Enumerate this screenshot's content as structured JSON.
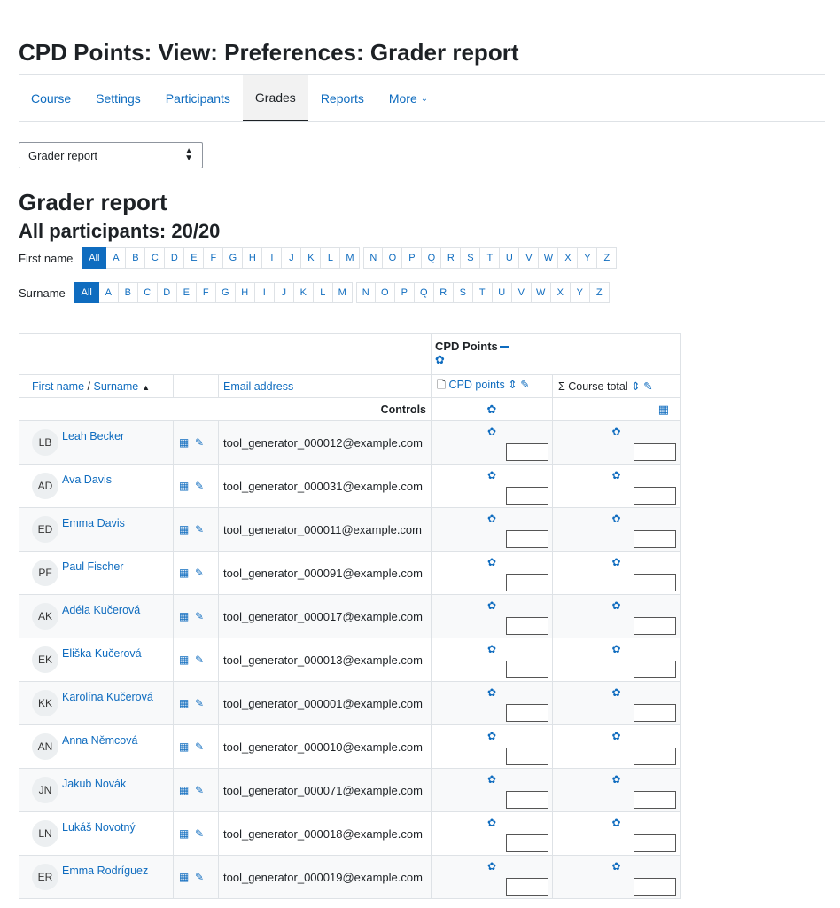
{
  "page": {
    "title": "CPD Points: View: Preferences: Grader report"
  },
  "nav": {
    "tabs": [
      {
        "label": "Course"
      },
      {
        "label": "Settings"
      },
      {
        "label": "Participants"
      },
      {
        "label": "Grades"
      },
      {
        "label": "Reports"
      },
      {
        "label": "More"
      }
    ],
    "active": "Grades"
  },
  "report_select": {
    "value": "Grader report"
  },
  "heading": "Grader report",
  "participants": "All participants: 20/20",
  "first_name_filter": {
    "label": "First name",
    "letters": [
      "All",
      "A",
      "B",
      "C",
      "D",
      "E",
      "F",
      "G",
      "H",
      "I",
      "J",
      "K",
      "L",
      "M",
      "N",
      "O",
      "P",
      "Q",
      "R",
      "S",
      "T",
      "U",
      "V",
      "W",
      "X",
      "Y",
      "Z"
    ]
  },
  "surname_filter": {
    "label": "Surname",
    "letters": [
      "All",
      "A",
      "B",
      "C",
      "D",
      "E",
      "F",
      "G",
      "H",
      "I",
      "J",
      "K",
      "L",
      "M",
      "N",
      "O",
      "P",
      "Q",
      "R",
      "S",
      "T",
      "U",
      "V",
      "W",
      "X",
      "Y",
      "Z"
    ]
  },
  "table": {
    "category": "CPD Points",
    "col_firstname": "First name",
    "col_sep": "/",
    "col_surname": "Surname",
    "col_email": "Email address",
    "col_cpd": "CPD points",
    "col_total": "Course total",
    "controls": "Controls",
    "rows": [
      {
        "initials": "LB",
        "name": "Leah Becker",
        "email": "tool_generator_000012@example.com"
      },
      {
        "initials": "AD",
        "name": "Ava Davis",
        "email": "tool_generator_000031@example.com"
      },
      {
        "initials": "ED",
        "name": "Emma Davis",
        "email": "tool_generator_000011@example.com"
      },
      {
        "initials": "PF",
        "name": "Paul Fischer",
        "email": "tool_generator_000091@example.com"
      },
      {
        "initials": "AK",
        "name": "Adéla Kučerová",
        "email": "tool_generator_000017@example.com"
      },
      {
        "initials": "EK",
        "name": "Eliška Kučerová",
        "email": "tool_generator_000013@example.com"
      },
      {
        "initials": "KK",
        "name": "Karolína Kučerová",
        "email": "tool_generator_000001@example.com"
      },
      {
        "initials": "AN",
        "name": "Anna Němcová",
        "email": "tool_generator_000010@example.com"
      },
      {
        "initials": "JN",
        "name": "Jakub Novák",
        "email": "tool_generator_000071@example.com"
      },
      {
        "initials": "LN",
        "name": "Lukáš Novotný",
        "email": "tool_generator_000018@example.com"
      },
      {
        "initials": "ER",
        "name": "Emma Rodríguez",
        "email": "tool_generator_000019@example.com"
      }
    ]
  },
  "colors": {
    "accent": "#0f6cbf",
    "border": "#dee2e6"
  },
  "icons": {
    "cog": "cog-icon",
    "pencil": "pencil-icon",
    "grid": "table-icon",
    "sort": "sort-icon",
    "calculator": "calculator-icon",
    "sigma": "sigma-icon",
    "assign": "activity-icon"
  }
}
